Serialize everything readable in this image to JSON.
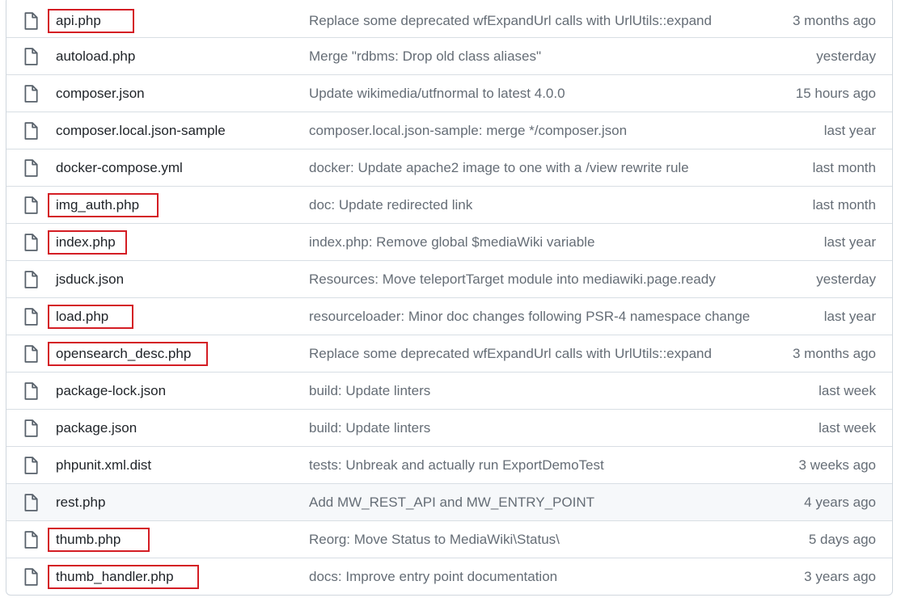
{
  "files": [
    {
      "name": "api.php",
      "message": "Replace some deprecated wfExpandUrl calls with UrlUtils::expand",
      "time": "3 months ago",
      "highlighted": true,
      "box_width": 107
    },
    {
      "name": "autoload.php",
      "message": "Merge \"rdbms: Drop old class aliases\"",
      "time": "yesterday",
      "highlighted": false
    },
    {
      "name": "composer.json",
      "message": "Update wikimedia/utfnormal to latest 4.0.0",
      "time": "15 hours ago",
      "highlighted": false
    },
    {
      "name": "composer.local.json-sample",
      "message": "composer.local.json-sample: merge */composer.json",
      "time": "last year",
      "highlighted": false
    },
    {
      "name": "docker-compose.yml",
      "message": "docker: Update apache2 image to one with a /view rewrite rule",
      "time": "last month",
      "highlighted": false
    },
    {
      "name": "img_auth.php",
      "message": "doc: Update redirected link",
      "time": "last month",
      "highlighted": true,
      "box_width": 137
    },
    {
      "name": "index.php",
      "message": "index.php: Remove global $mediaWiki variable",
      "time": "last year",
      "highlighted": true,
      "box_width": 98
    },
    {
      "name": "jsduck.json",
      "message": "Resources: Move teleportTarget module into mediawiki.page.ready",
      "time": "yesterday",
      "highlighted": false
    },
    {
      "name": "load.php",
      "message": "resourceloader: Minor doc changes following PSR-4 namespace change",
      "time": "last year",
      "highlighted": true,
      "box_width": 106
    },
    {
      "name": "opensearch_desc.php",
      "message": "Replace some deprecated wfExpandUrl calls with UrlUtils::expand",
      "time": "3 months ago",
      "highlighted": true,
      "box_width": 198
    },
    {
      "name": "package-lock.json",
      "message": "build: Update linters",
      "time": "last week",
      "highlighted": false
    },
    {
      "name": "package.json",
      "message": "build: Update linters",
      "time": "last week",
      "highlighted": false
    },
    {
      "name": "phpunit.xml.dist",
      "message": "tests: Unbreak and actually run ExportDemoTest",
      "time": "3 weeks ago",
      "highlighted": false
    },
    {
      "name": "rest.php",
      "message": "Add MW_REST_API and MW_ENTRY_POINT",
      "time": "4 years ago",
      "highlighted": false,
      "hover": true
    },
    {
      "name": "thumb.php",
      "message": "Reorg: Move Status to MediaWiki\\Status\\",
      "time": "5 days ago",
      "highlighted": true,
      "box_width": 126
    },
    {
      "name": "thumb_handler.php",
      "message": "docs: Improve entry point documentation",
      "time": "3 years ago",
      "highlighted": true,
      "box_width": 187
    }
  ],
  "icons": {
    "file": "file-icon"
  },
  "colors": {
    "highlight_border": "#d41d24",
    "hover_bg": "#f6f8fa",
    "muted_text": "#656d76"
  }
}
